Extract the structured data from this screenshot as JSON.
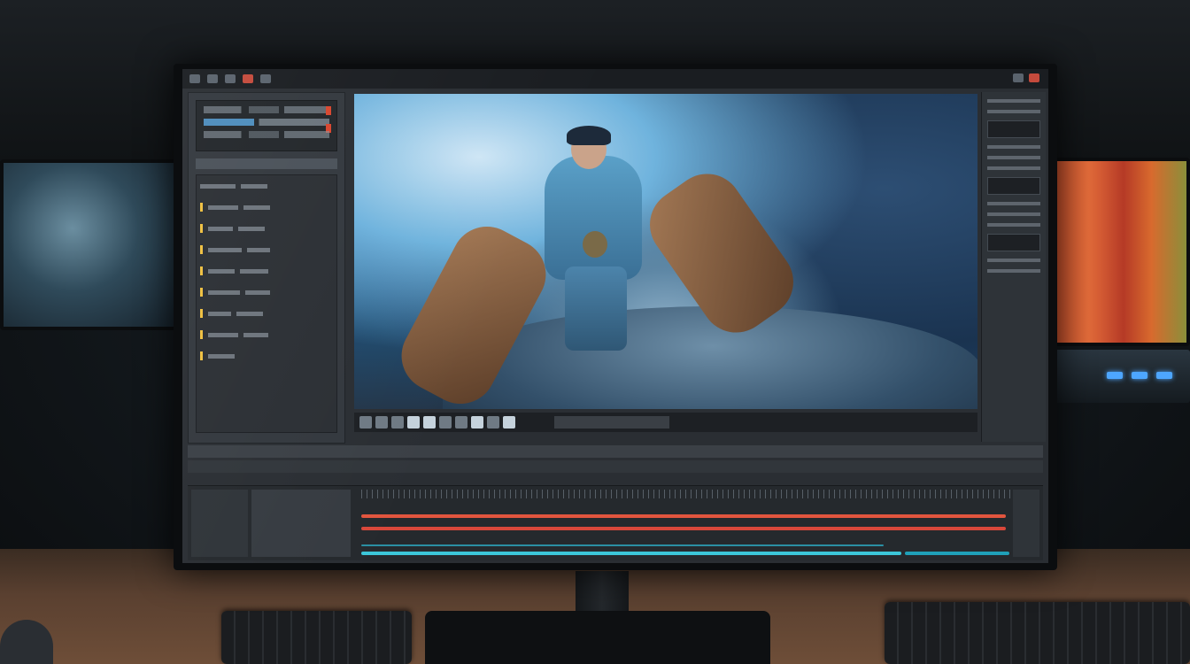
{
  "scene": {
    "description_items": [
      "side-monitor-left",
      "side-monitor-right",
      "desk",
      "keyboards",
      "monitor-stand"
    ]
  },
  "editor": {
    "title": "",
    "panels": {
      "media_list_count": 9,
      "timeline_tracks": [
        "red",
        "red",
        "cyan"
      ]
    },
    "colors": {
      "accent_red": "#e2553e",
      "accent_cyan": "#3cc6d8",
      "accent_blue": "#58a6e0",
      "accent_yellow": "#f0c040"
    }
  }
}
